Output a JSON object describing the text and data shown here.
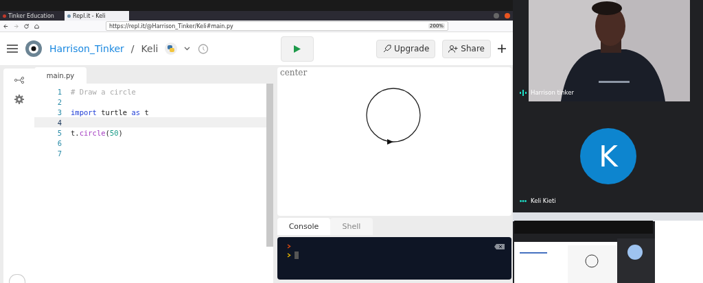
{
  "browser": {
    "tabs": [
      {
        "label": "Tinker Education",
        "selected": false
      },
      {
        "label": "Repl.it - Keli",
        "selected": true
      }
    ],
    "url": "https://repl.it/@Harrison_Tinker/Keli#main.py",
    "zoom": "200%"
  },
  "header": {
    "owner": "Harrison_Tinker",
    "separator": "/",
    "repl": "Keli",
    "buttons": [
      {
        "label": "Upgrade",
        "kind": "upgrade"
      },
      {
        "label": "Share",
        "kind": "share"
      }
    ]
  },
  "editor": {
    "file_tab": "main.py",
    "lines": [
      {
        "number": "1",
        "active": false,
        "tokens": [
          {
            "text": "# Draw a circle",
            "kind": "comment"
          }
        ]
      },
      {
        "number": "2",
        "active": false
      },
      {
        "number": "3",
        "active": false,
        "tokens": [
          {
            "text": "import",
            "kind": "keyword"
          },
          {
            "text": " turtle ",
            "kind": "plain"
          },
          {
            "text": "as",
            "kind": "keyword"
          },
          {
            "text": " t",
            "kind": "plain"
          }
        ]
      },
      {
        "number": "4",
        "active": true
      },
      {
        "number": "5",
        "active": false,
        "tokens": [
          {
            "text": "t.",
            "kind": "plain"
          },
          {
            "text": "circle",
            "kind": "call"
          },
          {
            "text": "(",
            "kind": "plain"
          },
          {
            "text": "50",
            "kind": "number"
          },
          {
            "text": ")",
            "kind": "plain"
          }
        ]
      },
      {
        "number": "6",
        "active": false
      },
      {
        "number": "7",
        "active": false
      }
    ]
  },
  "output": {
    "label": "center"
  },
  "console": {
    "tabs": [
      {
        "label": "Console",
        "selected": true
      },
      {
        "label": "Shell",
        "selected": false
      }
    ]
  },
  "call": {
    "tiles": [
      {
        "kind": "video",
        "name": "Harrison tinker",
        "speaking": true
      },
      {
        "kind": "avatar",
        "initial": "K",
        "name": "Keli Kieti",
        "speaking": false
      },
      {
        "kind": "screen"
      }
    ]
  }
}
